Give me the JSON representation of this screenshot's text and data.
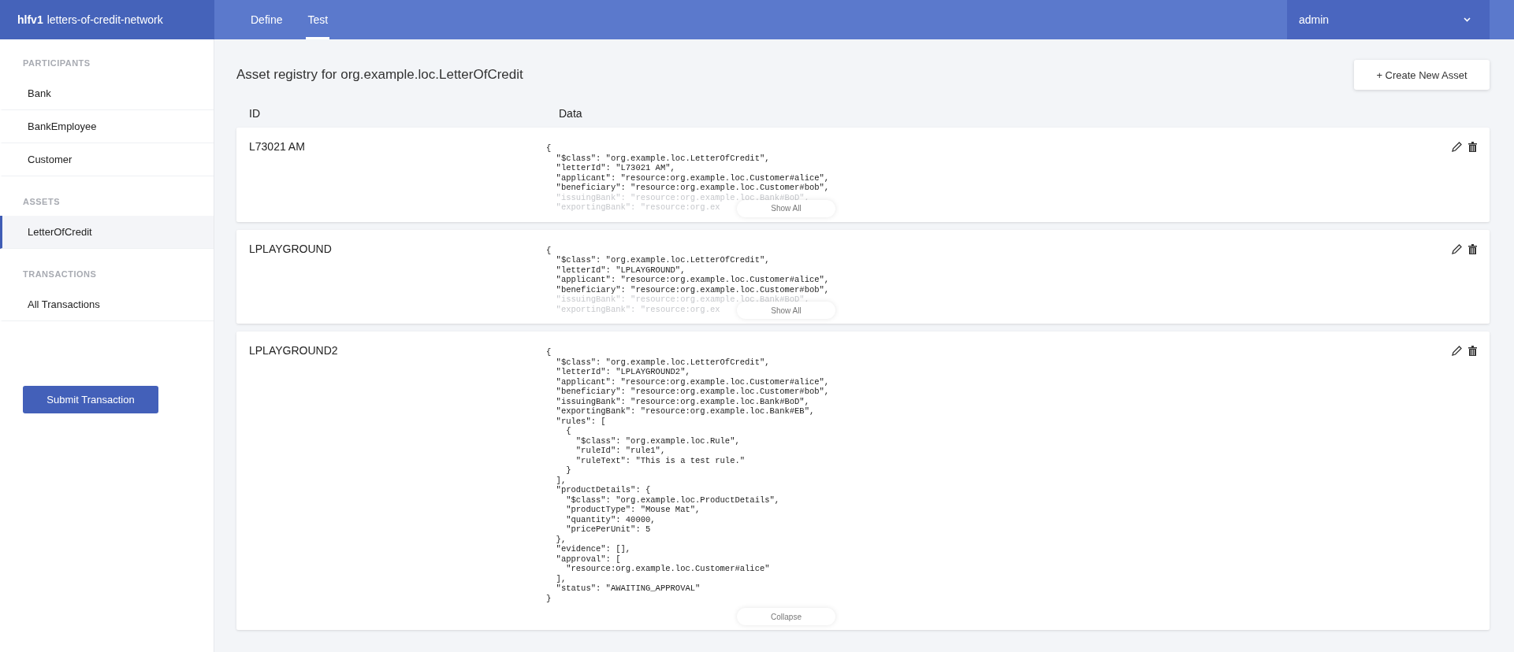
{
  "brand": {
    "bold": "hlfv1",
    "name": "letters-of-credit-network"
  },
  "nav_tabs": [
    {
      "label": "Define",
      "selected": false
    },
    {
      "label": "Test",
      "selected": true
    }
  ],
  "user_menu": {
    "label": "admin"
  },
  "sidebar": {
    "sections": [
      {
        "heading": "PARTICIPANTS",
        "items": [
          {
            "label": "Bank",
            "selected": false
          },
          {
            "label": "BankEmployee",
            "selected": false
          },
          {
            "label": "Customer",
            "selected": false
          }
        ]
      },
      {
        "heading": "ASSETS",
        "items": [
          {
            "label": "LetterOfCredit",
            "selected": true
          }
        ]
      },
      {
        "heading": "TRANSACTIONS",
        "items": [
          {
            "label": "All Transactions",
            "selected": false
          }
        ]
      }
    ],
    "submit_button": "Submit Transaction"
  },
  "main": {
    "title": "Asset registry for org.example.loc.LetterOfCredit",
    "create_button": "+ Create New Asset",
    "columns": [
      "ID",
      "Data"
    ],
    "assets": [
      {
        "id": "L73021 AM",
        "expanded": false,
        "toggle": "Show All",
        "lines": [
          {
            "text": "{",
            "faded": false
          },
          {
            "text": "  \"$class\": \"org.example.loc.LetterOfCredit\",",
            "faded": false
          },
          {
            "text": "  \"letterId\": \"L73021 AM\",",
            "faded": false
          },
          {
            "text": "  \"applicant\": \"resource:org.example.loc.Customer#alice\",",
            "faded": false
          },
          {
            "text": "  \"beneficiary\": \"resource:org.example.loc.Customer#bob\",",
            "faded": false
          },
          {
            "text": "  \"issuingBank\": \"resource:org.example.loc.Bank#BoD\",",
            "faded": true
          },
          {
            "text": "  \"exportingBank\": \"resource:org.ex",
            "faded": true
          }
        ]
      },
      {
        "id": "LPLAYGROUND",
        "expanded": false,
        "toggle": "Show All",
        "lines": [
          {
            "text": "{",
            "faded": false
          },
          {
            "text": "  \"$class\": \"org.example.loc.LetterOfCredit\",",
            "faded": false
          },
          {
            "text": "  \"letterId\": \"LPLAYGROUND\",",
            "faded": false
          },
          {
            "text": "  \"applicant\": \"resource:org.example.loc.Customer#alice\",",
            "faded": false
          },
          {
            "text": "  \"beneficiary\": \"resource:org.example.loc.Customer#bob\",",
            "faded": false
          },
          {
            "text": "  \"issuingBank\": \"resource:org.example.loc.Bank#BoD\",",
            "faded": true
          },
          {
            "text": "  \"exportingBank\": \"resource:org.ex",
            "faded": true
          }
        ]
      },
      {
        "id": "LPLAYGROUND2",
        "expanded": true,
        "toggle": "Collapse",
        "lines": [
          {
            "text": "{",
            "faded": false
          },
          {
            "text": "  \"$class\": \"org.example.loc.LetterOfCredit\",",
            "faded": false
          },
          {
            "text": "  \"letterId\": \"LPLAYGROUND2\",",
            "faded": false
          },
          {
            "text": "  \"applicant\": \"resource:org.example.loc.Customer#alice\",",
            "faded": false
          },
          {
            "text": "  \"beneficiary\": \"resource:org.example.loc.Customer#bob\",",
            "faded": false
          },
          {
            "text": "  \"issuingBank\": \"resource:org.example.loc.Bank#BoD\",",
            "faded": false
          },
          {
            "text": "  \"exportingBank\": \"resource:org.example.loc.Bank#EB\",",
            "faded": false
          },
          {
            "text": "  \"rules\": [",
            "faded": false
          },
          {
            "text": "    {",
            "faded": false
          },
          {
            "text": "      \"$class\": \"org.example.loc.Rule\",",
            "faded": false
          },
          {
            "text": "      \"ruleId\": \"rule1\",",
            "faded": false
          },
          {
            "text": "      \"ruleText\": \"This is a test rule.\"",
            "faded": false
          },
          {
            "text": "    }",
            "faded": false
          },
          {
            "text": "  ],",
            "faded": false
          },
          {
            "text": "  \"productDetails\": {",
            "faded": false
          },
          {
            "text": "    \"$class\": \"org.example.loc.ProductDetails\",",
            "faded": false
          },
          {
            "text": "    \"productType\": \"Mouse Mat\",",
            "faded": false
          },
          {
            "text": "    \"quantity\": 40000,",
            "faded": false
          },
          {
            "text": "    \"pricePerUnit\": 5",
            "faded": false
          },
          {
            "text": "  },",
            "faded": false
          },
          {
            "text": "  \"evidence\": [],",
            "faded": false
          },
          {
            "text": "  \"approval\": [",
            "faded": false
          },
          {
            "text": "    \"resource:org.example.loc.Customer#alice\"",
            "faded": false
          },
          {
            "text": "  ],",
            "faded": false
          },
          {
            "text": "  \"status\": \"AWAITING_APPROVAL\"",
            "faded": false
          },
          {
            "text": "}",
            "faded": false
          }
        ]
      }
    ]
  }
}
